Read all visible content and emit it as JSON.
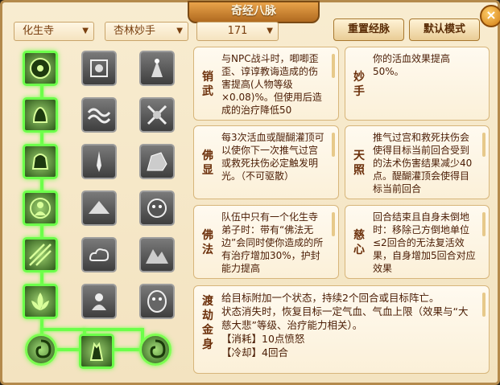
{
  "window": {
    "title": "奇经八脉"
  },
  "toolbar": {
    "sect": "化生寺",
    "school": "杏林妙手",
    "points": "171",
    "reset_label": "重置经脉",
    "default_label": "默认模式"
  },
  "colors": {
    "active": "#6cff4a",
    "accent": "#7a4010"
  },
  "skills": [
    {
      "name": "销\n武",
      "desc": "与NPC战斗时，唧唧歪歪、谆谆教诲造成的伤害提高(人物等级×0.08)%。但使用后造成的治疗降低50"
    },
    {
      "name": "妙\n手",
      "desc": "你的活血效果提高50%。"
    },
    {
      "name": "佛\n显",
      "desc": "每3次活血或醍醐灌顶可以使你下一次推气过宫或救死扶伤必定触发明光。（不可驱散）"
    },
    {
      "name": "天\n照",
      "desc": "推气过宫和救死扶伤会使得目标当前回合受到的法术伤害结果减少40点。醍醐灌顶会使得目标当前回合"
    },
    {
      "name": "佛\n法",
      "desc": "队伍中只有一个化生寺弟子时：带有“佛法无边”会同时使你造成的所有治疗增加30%，护封能力提高"
    },
    {
      "name": "慈\n心",
      "desc": "回合结束且自身未倒地时：移除己方倒地单位≤2回合的无法复活效果，自身增加5回合对应效果"
    },
    {
      "name": "渡\n劫\n金\n身",
      "desc": "给目标附加一个状态，持续2个回合或目标阵亡。\n状态消失时，恢复目标一定气血、气血上限（效果与“大慈大悲”等级、治疗能力相关）。\n【消耗】10点愤怒\n【冷却】4回合"
    }
  ],
  "tree_icons": [
    [
      "palm-icon",
      "medallion-icon",
      "dancer-icon"
    ],
    [
      "hand-icon",
      "wave-icon",
      "cross-icon"
    ],
    [
      "bell-icon",
      "sword-icon",
      "rock-icon"
    ],
    [
      "buddha-icon",
      "altar-icon",
      "face-icon"
    ],
    [
      "rays-icon",
      "cloud-icon",
      "mountain-icon"
    ],
    [
      "lotus-icon",
      "monk-icon",
      "mask-icon"
    ]
  ]
}
